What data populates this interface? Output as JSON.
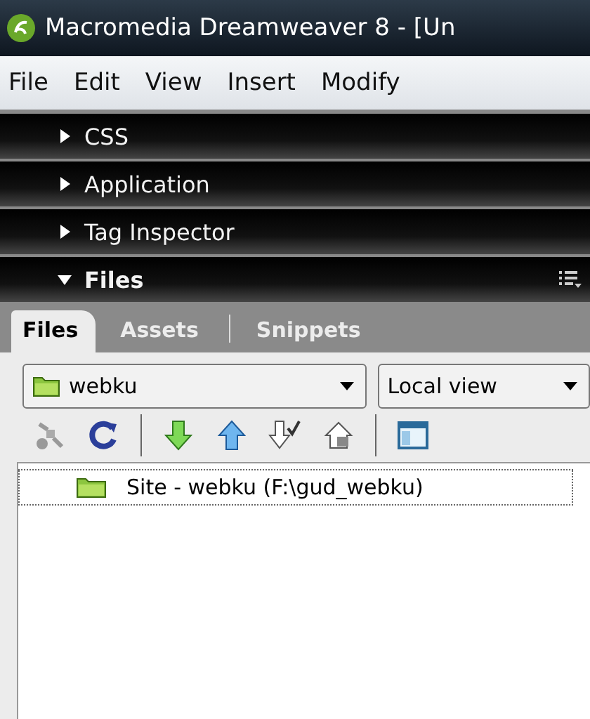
{
  "window": {
    "title": "Macromedia Dreamweaver 8 - [Un"
  },
  "menu": [
    "File",
    "Edit",
    "View",
    "Insert",
    "Modify"
  ],
  "panels": [
    {
      "title": "CSS",
      "expanded": false
    },
    {
      "title": "Application",
      "expanded": false
    },
    {
      "title": "Tag Inspector",
      "expanded": false
    },
    {
      "title": "Files",
      "expanded": true
    }
  ],
  "tabs": [
    {
      "label": "Files",
      "selected": true
    },
    {
      "label": "Assets",
      "selected": false
    },
    {
      "label": "Snippets",
      "selected": false
    }
  ],
  "site_select": {
    "value": "webku"
  },
  "view_select": {
    "value": "Local view"
  },
  "toolbar": [
    {
      "kind": "connect"
    },
    {
      "kind": "refresh"
    },
    {
      "kind": "separator"
    },
    {
      "kind": "get"
    },
    {
      "kind": "put"
    },
    {
      "kind": "checkout"
    },
    {
      "kind": "checkin"
    },
    {
      "kind": "separator"
    },
    {
      "kind": "expand"
    }
  ],
  "tree": [
    {
      "label": "Site - webku (F:\\gud_webku)"
    }
  ]
}
